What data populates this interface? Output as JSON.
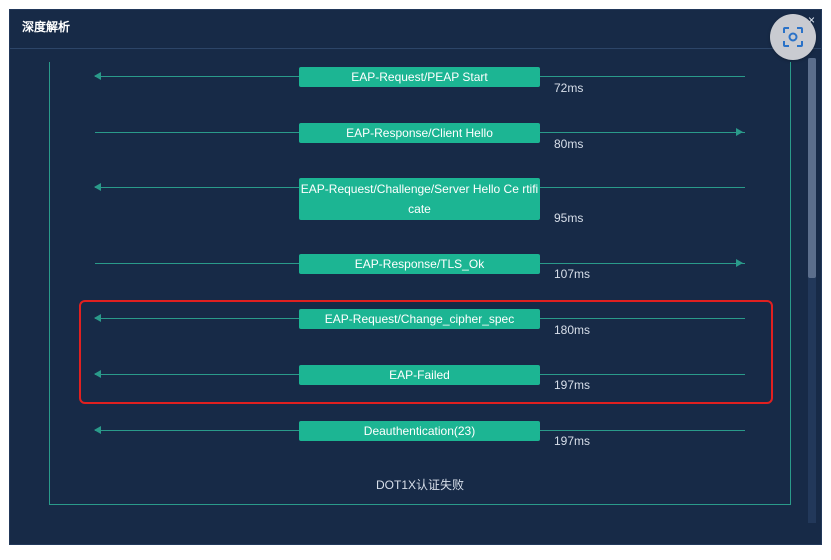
{
  "dialog": {
    "title": "深度解析",
    "close": "×"
  },
  "messages": [
    {
      "label": "EAP-Request/PEAP Start",
      "time": "72ms",
      "direction": "left"
    },
    {
      "label": "EAP-Response/Client Hello",
      "time": "80ms",
      "direction": "right"
    },
    {
      "label": "EAP-Request/Challenge/Server Hello Ce rtificate",
      "time": "95ms",
      "direction": "left"
    },
    {
      "label": "EAP-Response/TLS_Ok",
      "time": "107ms",
      "direction": "right"
    },
    {
      "label": "EAP-Request/Change_cipher_spec",
      "time": "180ms",
      "direction": "left"
    },
    {
      "label": "EAP-Failed",
      "time": "197ms",
      "direction": "left"
    },
    {
      "label": "Deauthentication(23)",
      "time": "197ms",
      "direction": "left"
    }
  ],
  "result": "DOT1X认证失败",
  "colors": {
    "background": "#172a47",
    "line": "#2a9a8a",
    "message_box": "#1cb593",
    "highlight": "#e02020"
  },
  "icons": {
    "scan": "scan-icon",
    "close": "close-icon"
  }
}
